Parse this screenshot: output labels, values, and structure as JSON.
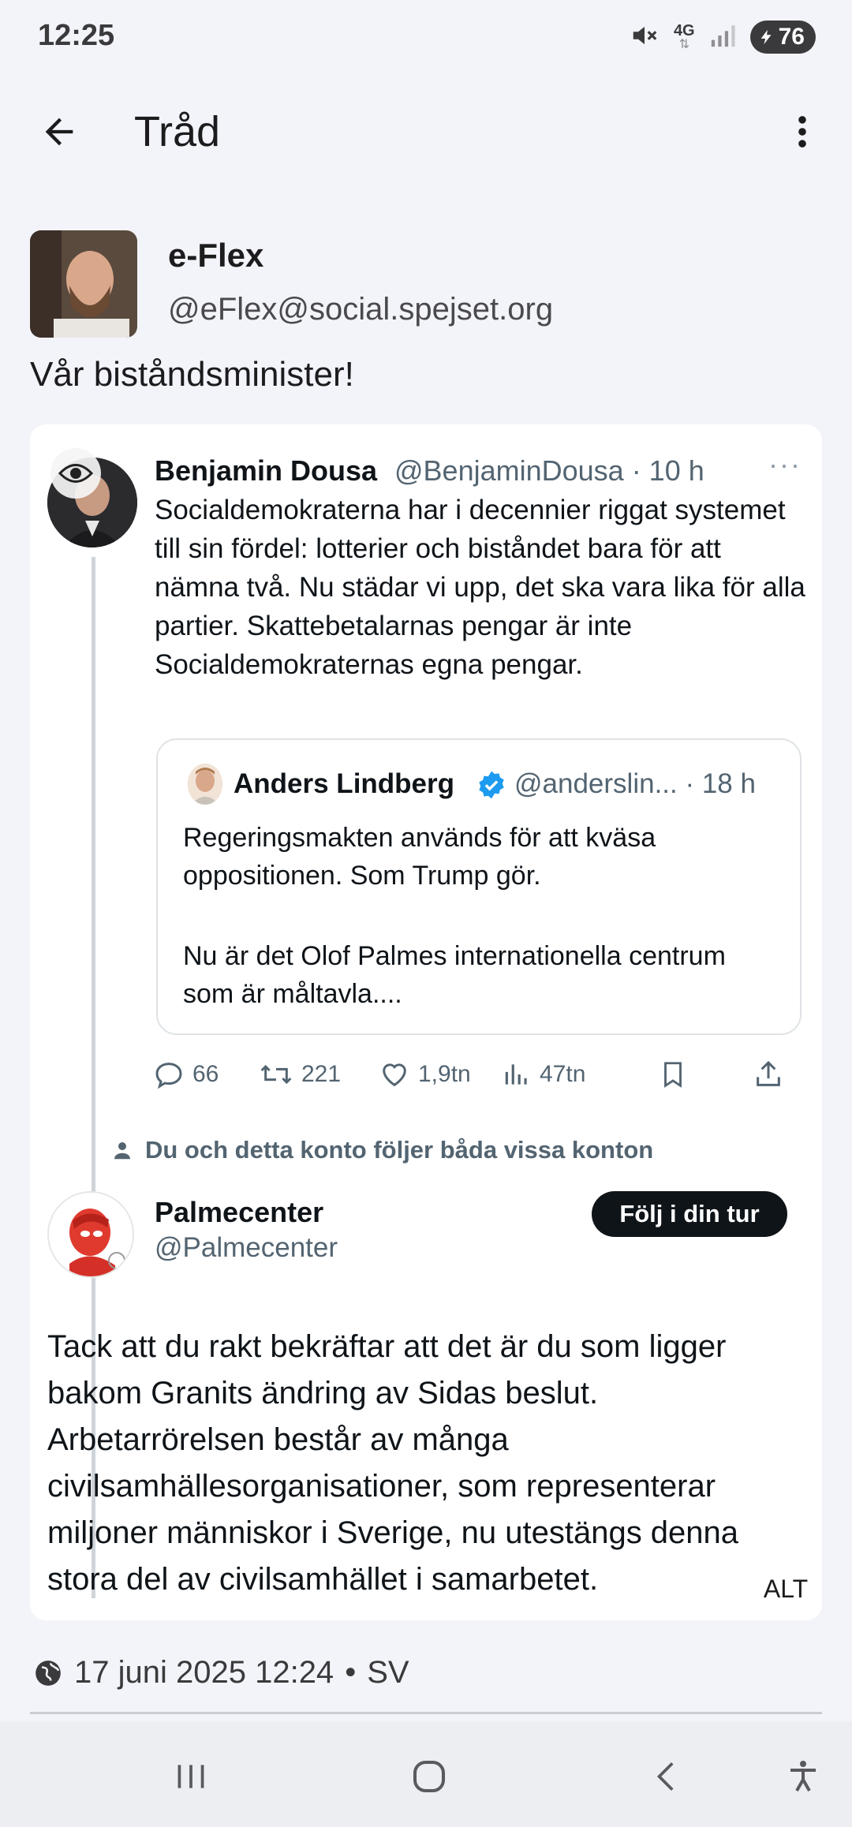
{
  "status_bar": {
    "time": "12:25",
    "network": "4G",
    "battery": "76",
    "icons": [
      "mute-icon",
      "network-4g-icon",
      "signal-icon",
      "battery-icon"
    ]
  },
  "appbar": {
    "title": "Tråd",
    "back_icon": "arrow-left-icon",
    "more_icon": "more-vert-icon"
  },
  "post": {
    "author_name": "e-Flex",
    "author_handle": "@eFlex@social.spejset.org",
    "text": "Vår biståndsminister!",
    "date": "17 juni 2025 12:24",
    "separator": "•",
    "language": "SV"
  },
  "media": {
    "alt_label": "ALT",
    "tweet": {
      "name": "Benjamin Dousa",
      "handle_time": "@BenjaminDousa · 10 h",
      "dots": "···",
      "text": "Socialdemokraterna har i decennier riggat systemet till sin fördel: lotterier och biståndet bara för att nämna två. Nu städar vi upp, det ska vara lika för alla partier. Skattebetalarnas pengar är inte Socialdemokraternas egna pengar."
    },
    "quote": {
      "name": "Anders Lindberg",
      "handle_time": "@anderslin... · 18 h",
      "text1": "Regeringsmakten används för att kväsa oppositionen. Som Trump gör.",
      "text2": "Nu är det Olof Palmes internationella centrum som är måltavla...."
    },
    "actions": {
      "replies": "66",
      "reposts": "221",
      "likes": "1,9tn",
      "views": "47tn"
    },
    "follows_note": "Du och detta konto följer båda vissa konton",
    "reply": {
      "name": "Palmecenter",
      "handle": "@Palmecenter",
      "follow_label": "Följ i din tur",
      "text": "Tack att du rakt bekräftar att det är du som ligger bakom Granits ändring av Sidas beslut. Arbetarrörelsen består av många civilsamhällesorganisationer, som representerar miljoner människor i Sverige, nu utestängs denna stora del av civilsamhället i samarbetet."
    }
  },
  "colors": {
    "background": "#f3f4f9",
    "text": "#1c1c1e",
    "x_muted": "#536471",
    "verified": "#1d9bf0"
  }
}
